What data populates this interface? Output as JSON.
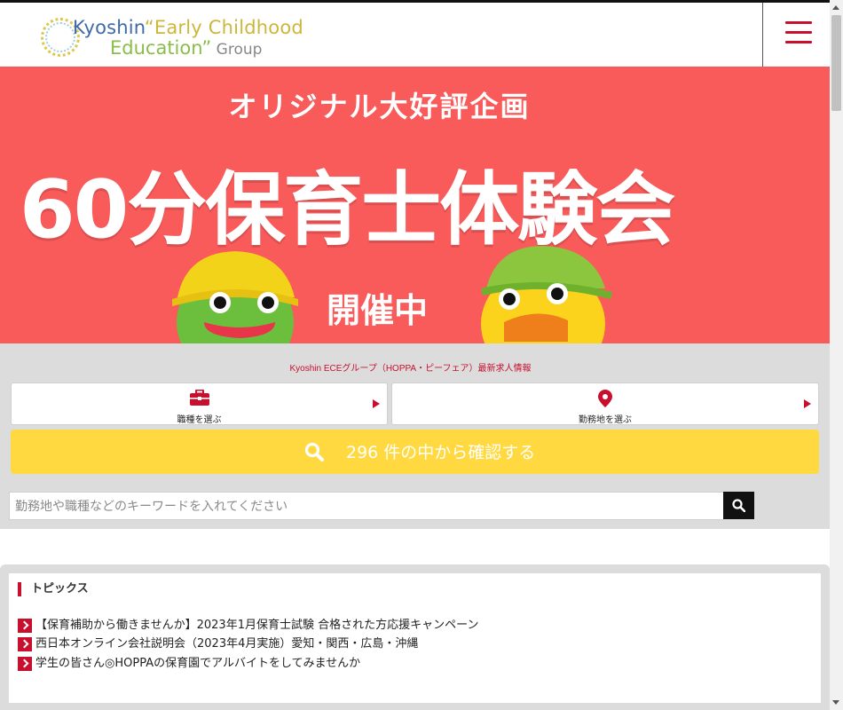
{
  "header": {
    "logo": {
      "line1_a": "Kyoshin",
      "line1_b": "“Early Childhood",
      "line2_a": "Education”",
      "line2_b": " Group"
    },
    "menu_icon": "hamburger-menu-icon"
  },
  "banner": {
    "subtitle": "オリジナル大好評企画",
    "title": "60分保育士体験会",
    "tag": "開催中",
    "colors": {
      "background": "#f95a5a"
    }
  },
  "search": {
    "caption": "Kyoshin ECEグループ（HOPPA・ピーフェア）最新求人情報",
    "job_type_label": "職種を選ぶ",
    "location_label": "勤務地を選ぶ",
    "confirm_label": "296 件の中から確認する",
    "keyword_placeholder": "勤務地や職種などのキーワードを入れてください",
    "keyword_value": ""
  },
  "topics": {
    "title": "トピックス",
    "items": [
      "【保育補助から働きませんか】2023年1月保育士試験 合格された方応援キャンペーン",
      "西日本オンライン会社説明会（2023年4月実施）愛知・関西・広島・沖縄",
      "学生の皆さん◎HOPPAの保育園でアルバイトをしてみませんか"
    ]
  },
  "colors": {
    "accent": "#c8102e",
    "confirm_button": "#ffd93f",
    "search_bg": "#dcdcdc"
  }
}
